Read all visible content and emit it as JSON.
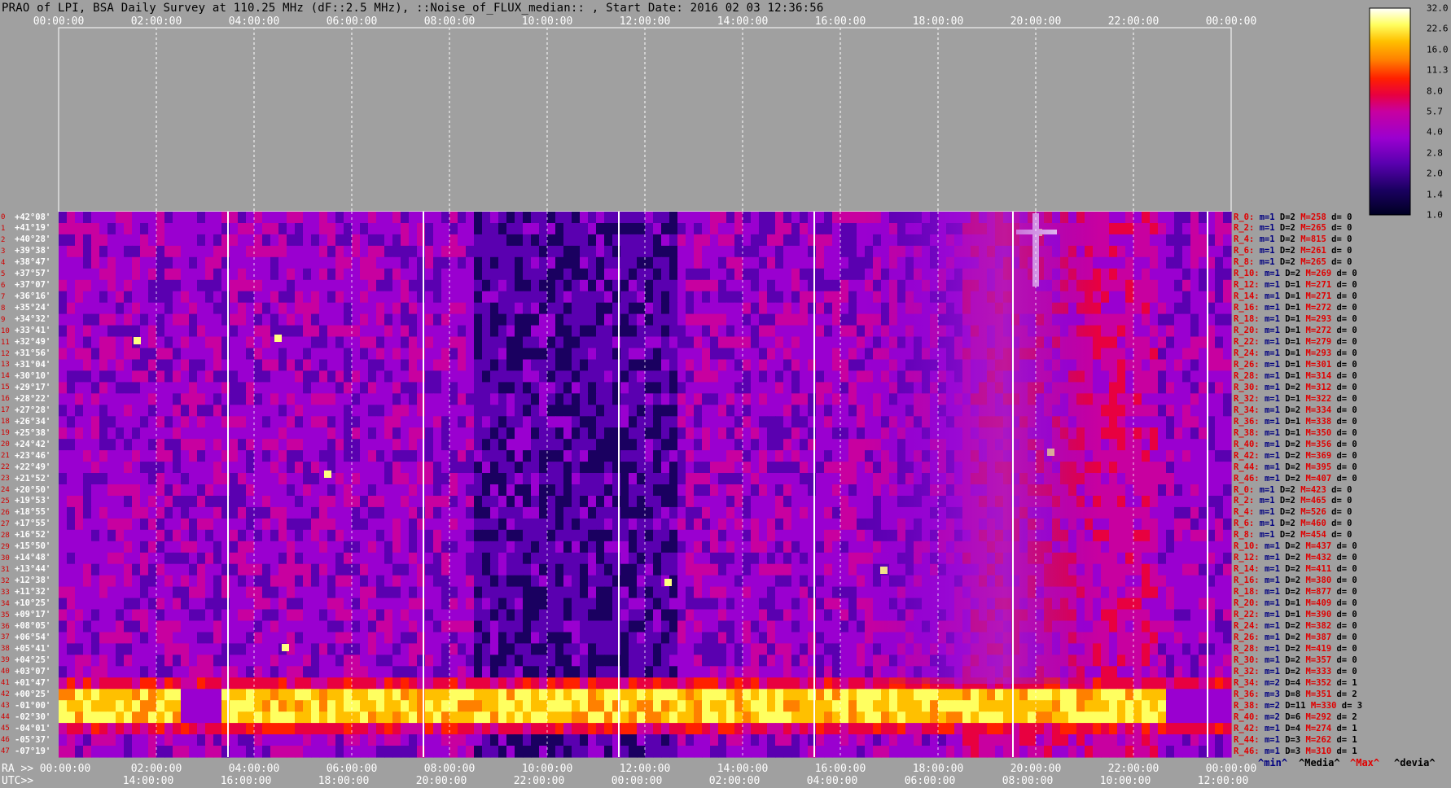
{
  "title": "PRAO of LPI, BSA Daily Survey at 110.25 MHz (dF::2.5 MHz), ::Noise_of_FLUX_median:: , Start Date: 2016 02 03 12:36:56",
  "chart_data": {
    "type": "heatmap",
    "top_axis_ticks": [
      "00:00:00",
      "02:00:00",
      "04:00:00",
      "06:00:00",
      "08:00:00",
      "10:00:00",
      "12:00:00",
      "14:00:00",
      "16:00:00",
      "18:00:00",
      "20:00:00",
      "22:00:00",
      "00:00:00"
    ],
    "ra_axis_label": "RA >>",
    "ra_axis_ticks": [
      "00:00:00",
      "02:00:00",
      "04:00:00",
      "06:00:00",
      "08:00:00",
      "10:00:00",
      "12:00:00",
      "14:00:00",
      "16:00:00",
      "18:00:00",
      "20:00:00",
      "22:00:00",
      "00:00:00"
    ],
    "utc_axis_label": "UTC>>",
    "utc_axis_ticks": [
      "14:00:00",
      "16:00:00",
      "18:00:00",
      "20:00:00",
      "22:00:00",
      "00:00:00",
      "02:00:00",
      "04:00:00",
      "06:00:00",
      "08:00:00",
      "10:00:00",
      "12:00:00"
    ],
    "declinations": [
      "+42°08'",
      "+41°19'",
      "+40°28'",
      "+39°38'",
      "+38°47'",
      "+37°57'",
      "+37°07'",
      "+36°16'",
      "+35°24'",
      "+34°32'",
      "+33°41'",
      "+32°49'",
      "+31°56'",
      "+31°04'",
      "+30°10'",
      "+29°17'",
      "+28°22'",
      "+27°28'",
      "+26°34'",
      "+25°38'",
      "+24°42'",
      "+23°46'",
      "+22°49'",
      "+21°52'",
      "+20°50'",
      "+19°53'",
      "+18°55'",
      "+17°55'",
      "+16°52'",
      "+15°50'",
      "+14°48'",
      "+13°44'",
      "+12°38'",
      "+11°32'",
      "+10°25'",
      "+09°17'",
      "+08°05'",
      "+06°54'",
      "+05°41'",
      "+04°25'",
      "+03°07'",
      "+01°47'",
      "+00°25'",
      "-01°00'",
      "-02°30'",
      "-04°01'",
      "-05°37'",
      "-07°19'"
    ],
    "row_numbers": [
      "0",
      "1",
      "2",
      "3",
      "4",
      "5",
      "6",
      "7",
      "8",
      "9",
      "10",
      "11",
      "12",
      "13",
      "14",
      "15",
      "16",
      "17",
      "18",
      "19",
      "20",
      "21",
      "22",
      "23",
      "24",
      "25",
      "26",
      "27",
      "28",
      "29",
      "30",
      "31",
      "32",
      "33",
      "34",
      "35",
      "36",
      "37",
      "38",
      "39",
      "40",
      "41",
      "42",
      "43",
      "44",
      "45",
      "46",
      "47"
    ],
    "colorbar": {
      "ticks": [
        "32.0",
        "22.6",
        "16.0",
        "11.3",
        "8.0",
        "5.7",
        "4.0",
        "2.8",
        "2.0",
        "1.4",
        "1.0"
      ],
      "colors": [
        "#000022",
        "#1a0060",
        "#5a00b0",
        "#9a00d0",
        "#c800a0",
        "#e80040",
        "#ff2000",
        "#ff8000",
        "#ffc000",
        "#ffff60",
        "#ffffff"
      ]
    },
    "row_stats": [
      {
        "r": "R_0:",
        "m": "1",
        "D": "2",
        "M": "258",
        "d": "0"
      },
      {
        "r": "R_2:",
        "m": "1",
        "D": "2",
        "M": "265",
        "d": "0"
      },
      {
        "r": "R_4:",
        "m": "1",
        "D": "2",
        "M": "815",
        "d": "0"
      },
      {
        "r": "R_6:",
        "m": "1",
        "D": "2",
        "M": "261",
        "d": "0"
      },
      {
        "r": "R_8:",
        "m": "1",
        "D": "2",
        "M": "265",
        "d": "0"
      },
      {
        "r": "R_10:",
        "m": "1",
        "D": "2",
        "M": "269",
        "d": "0"
      },
      {
        "r": "R_12:",
        "m": "1",
        "D": "1",
        "M": "271",
        "d": "0"
      },
      {
        "r": "R_14:",
        "m": "1",
        "D": "1",
        "M": "271",
        "d": "0"
      },
      {
        "r": "R_16:",
        "m": "1",
        "D": "1",
        "M": "272",
        "d": "0"
      },
      {
        "r": "R_18:",
        "m": "1",
        "D": "1",
        "M": "293",
        "d": "0"
      },
      {
        "r": "R_20:",
        "m": "1",
        "D": "1",
        "M": "272",
        "d": "0"
      },
      {
        "r": "R_22:",
        "m": "1",
        "D": "1",
        "M": "279",
        "d": "0"
      },
      {
        "r": "R_24:",
        "m": "1",
        "D": "1",
        "M": "293",
        "d": "0"
      },
      {
        "r": "R_26:",
        "m": "1",
        "D": "1",
        "M": "301",
        "d": "0"
      },
      {
        "r": "R_28:",
        "m": "1",
        "D": "1",
        "M": "314",
        "d": "0"
      },
      {
        "r": "R_30:",
        "m": "1",
        "D": "2",
        "M": "312",
        "d": "0"
      },
      {
        "r": "R_32:",
        "m": "1",
        "D": "1",
        "M": "322",
        "d": "0"
      },
      {
        "r": "R_34:",
        "m": "1",
        "D": "2",
        "M": "334",
        "d": "0"
      },
      {
        "r": "R_36:",
        "m": "1",
        "D": "1",
        "M": "338",
        "d": "0"
      },
      {
        "r": "R_38:",
        "m": "1",
        "D": "1",
        "M": "350",
        "d": "0"
      },
      {
        "r": "R_40:",
        "m": "1",
        "D": "2",
        "M": "356",
        "d": "0"
      },
      {
        "r": "R_42:",
        "m": "1",
        "D": "2",
        "M": "369",
        "d": "0"
      },
      {
        "r": "R_44:",
        "m": "1",
        "D": "2",
        "M": "395",
        "d": "0"
      },
      {
        "r": "R_46:",
        "m": "1",
        "D": "2",
        "M": "407",
        "d": "0"
      },
      {
        "r": "R_0:",
        "m": "1",
        "D": "2",
        "M": "423",
        "d": "0"
      },
      {
        "r": "R_2:",
        "m": "1",
        "D": "2",
        "M": "465",
        "d": "0"
      },
      {
        "r": "R_4:",
        "m": "1",
        "D": "2",
        "M": "526",
        "d": "0"
      },
      {
        "r": "R_6:",
        "m": "1",
        "D": "2",
        "M": "460",
        "d": "0"
      },
      {
        "r": "R_8:",
        "m": "1",
        "D": "2",
        "M": "454",
        "d": "0"
      },
      {
        "r": "R_10:",
        "m": "1",
        "D": "2",
        "M": "437",
        "d": "0"
      },
      {
        "r": "R_12:",
        "m": "1",
        "D": "2",
        "M": "432",
        "d": "0"
      },
      {
        "r": "R_14:",
        "m": "1",
        "D": "2",
        "M": "411",
        "d": "0"
      },
      {
        "r": "R_16:",
        "m": "1",
        "D": "2",
        "M": "380",
        "d": "0"
      },
      {
        "r": "R_18:",
        "m": "1",
        "D": "2",
        "M": "877",
        "d": "0"
      },
      {
        "r": "R_20:",
        "m": "1",
        "D": "1",
        "M": "409",
        "d": "0"
      },
      {
        "r": "R_22:",
        "m": "1",
        "D": "1",
        "M": "390",
        "d": "0"
      },
      {
        "r": "R_24:",
        "m": "1",
        "D": "2",
        "M": "382",
        "d": "0"
      },
      {
        "r": "R_26:",
        "m": "1",
        "D": "2",
        "M": "387",
        "d": "0"
      },
      {
        "r": "R_28:",
        "m": "1",
        "D": "2",
        "M": "419",
        "d": "0"
      },
      {
        "r": "R_30:",
        "m": "1",
        "D": "2",
        "M": "357",
        "d": "0"
      },
      {
        "r": "R_32:",
        "m": "1",
        "D": "2",
        "M": "333",
        "d": "0"
      },
      {
        "r": "R_34:",
        "m": "2",
        "D": "4",
        "M": "352",
        "d": "1"
      },
      {
        "r": "R_36:",
        "m": "3",
        "D": "8",
        "M": "351",
        "d": "2"
      },
      {
        "r": "R_38:",
        "m": "2",
        "D": "11",
        "M": "330",
        "d": "3"
      },
      {
        "r": "R_40:",
        "m": "2",
        "D": "6",
        "M": "292",
        "d": "2"
      },
      {
        "r": "R_42:",
        "m": "1",
        "D": "4",
        "M": "274",
        "d": "1"
      },
      {
        "r": "R_44:",
        "m": "1",
        "D": "3",
        "M": "262",
        "d": "1"
      },
      {
        "r": "R_46:",
        "m": "1",
        "D": "3",
        "M": "310",
        "d": "1"
      }
    ],
    "stat_legend": [
      "^min^",
      "^Media^",
      "^Max^",
      "^devia^"
    ]
  }
}
